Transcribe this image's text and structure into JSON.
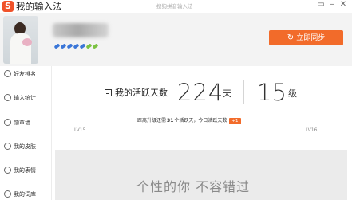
{
  "window": {
    "app_logo": "S",
    "title": "我的输入法",
    "subtitle": "搜狗拼音输入法",
    "menu_icon": "feedback-icon",
    "minimize_icon": "minimize-icon",
    "close_icon": "close-icon"
  },
  "banner": {
    "pen_colors": [
      "#3a76d8",
      "#3a76d8",
      "#3a76d8",
      "#3a76d8",
      "#3a76d8",
      "#7bc242",
      "#7bc242"
    ],
    "sync_icon": "sync-icon",
    "sync_label": "立即同步",
    "accent": "#f26b2a"
  },
  "sidebar": {
    "items": [
      {
        "label": "好友排名",
        "icon": "ranking-icon"
      },
      {
        "label": "输入统计",
        "icon": "statistics-icon"
      },
      {
        "label": "勋章墙",
        "icon": "medal-icon"
      },
      {
        "label": "我的皮肤",
        "icon": "skin-icon"
      },
      {
        "label": "我的表情",
        "icon": "emoji-icon"
      },
      {
        "label": "我的词库",
        "icon": "dictionary-icon"
      }
    ]
  },
  "stats": {
    "label": "我的活跃天数",
    "days": "224",
    "days_unit": "天",
    "level": "15",
    "level_unit": "级"
  },
  "upgrade": {
    "prefix": "距离升级还需",
    "days_needed": "31",
    "suffix": "个活跃天，今日活跃天数",
    "today_badge": "+1"
  },
  "progress": {
    "from_label": "LV15",
    "to_label": "LV16",
    "fraction": 0.02
  },
  "slogan": "个性的你 不容错过"
}
